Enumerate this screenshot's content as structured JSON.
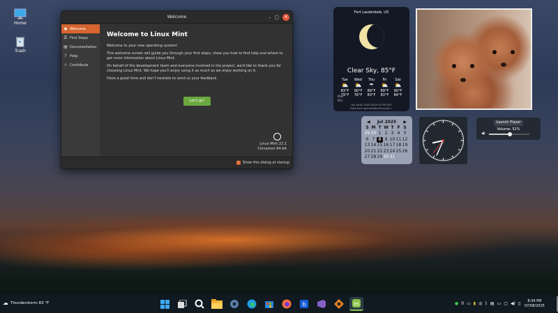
{
  "desktop": {
    "icons": [
      {
        "label": "Home",
        "icon": "monitor-icon"
      },
      {
        "label": "Trash",
        "icon": "trash-icon"
      }
    ]
  },
  "window": {
    "title": "Welcome",
    "controls": [
      "minimize",
      "maximize",
      "close"
    ],
    "sidebar": [
      {
        "label": "Welcome",
        "icon": "mint-icon",
        "active": true
      },
      {
        "label": "First Steps",
        "icon": "list-icon"
      },
      {
        "label": "Documentation",
        "icon": "book-icon"
      },
      {
        "label": "Help",
        "icon": "help-icon"
      },
      {
        "label": "Contribute",
        "icon": "star-icon"
      }
    ],
    "heading": "Welcome to Linux Mint",
    "paragraphs": [
      "Welcome to your new operating system!",
      "This welcome screen will guide you through your first steps, show you how to find help and where to get more information about Linux Mint.",
      "On behalf of the development team and everyone involved in the project, we'd like to thank you for choosing Linux Mint. We hope you'll enjoy using it as much as we enjoy working on it.",
      "Have a great time and don't hesitate to send us your feedback."
    ],
    "button": "Let's go!",
    "version": "Linux Mint 22.1",
    "edition": "Cinnamon 64-bit",
    "startup_checkbox": "Show this dialog at startup",
    "startup_checked": true
  },
  "weather": {
    "location": "Fort Lauderdale, US",
    "condition": "Clear Sky, 85°F",
    "forecast": [
      {
        "day": "Tue",
        "hi": "83°F",
        "lo": "79°F",
        "icon": "sun-cloud-icon"
      },
      {
        "day": "Wed",
        "hi": "90°F",
        "lo": "76°F",
        "icon": "sun-cloud-icon"
      },
      {
        "day": "Thu",
        "hi": "89°F",
        "lo": "83°F",
        "icon": "rain-icon"
      },
      {
        "day": "Fri",
        "hi": "89°F",
        "lo": "83°F",
        "icon": "sun-cloud-icon"
      },
      {
        "day": "Sat",
        "hi": "90°F",
        "lo": "84°F",
        "icon": "sun-cloud-icon"
      }
    ],
    "row_labels": [
      "Max",
      "Min"
    ],
    "updated": "Tue 08 Jul 2025 08:29:42 PM EDT",
    "source": "Data from openweathermap.org"
  },
  "calendar": {
    "month": "Jul 2025",
    "weekdays": [
      "S",
      "M",
      "T",
      "W",
      "T",
      "F",
      "S"
    ],
    "days": [
      "29",
      "30",
      "1",
      "2",
      "3",
      "4",
      "5",
      "6",
      "7",
      "8",
      "9",
      "10",
      "11",
      "12",
      "13",
      "14",
      "15",
      "16",
      "17",
      "18",
      "19",
      "20",
      "21",
      "22",
      "23",
      "24",
      "25",
      "26",
      "27",
      "28",
      "29",
      "30",
      "31"
    ],
    "today": "8"
  },
  "clock": {
    "time": "8:34"
  },
  "player": {
    "button": "Launch Player",
    "volume": "Volume: 52%",
    "volume_value": 0.52
  },
  "taskbar": {
    "weather": "Thunderstorm 83 °F",
    "apps": [
      "windows-icon",
      "task-view-icon",
      "search-icon",
      "file-explorer-icon",
      "settings-icon",
      "edge-icon",
      "store-icon",
      "firefox-icon",
      "bitwarden-icon",
      "visual-studio-icon",
      "app-icon",
      "mint-icon"
    ],
    "tray_count": "0",
    "time": "8:34 PM",
    "date": "07/08/2025"
  },
  "colors": {
    "accent": "#d6652f",
    "button": "#6aa83e",
    "window_bg": "#2f2f2f"
  }
}
